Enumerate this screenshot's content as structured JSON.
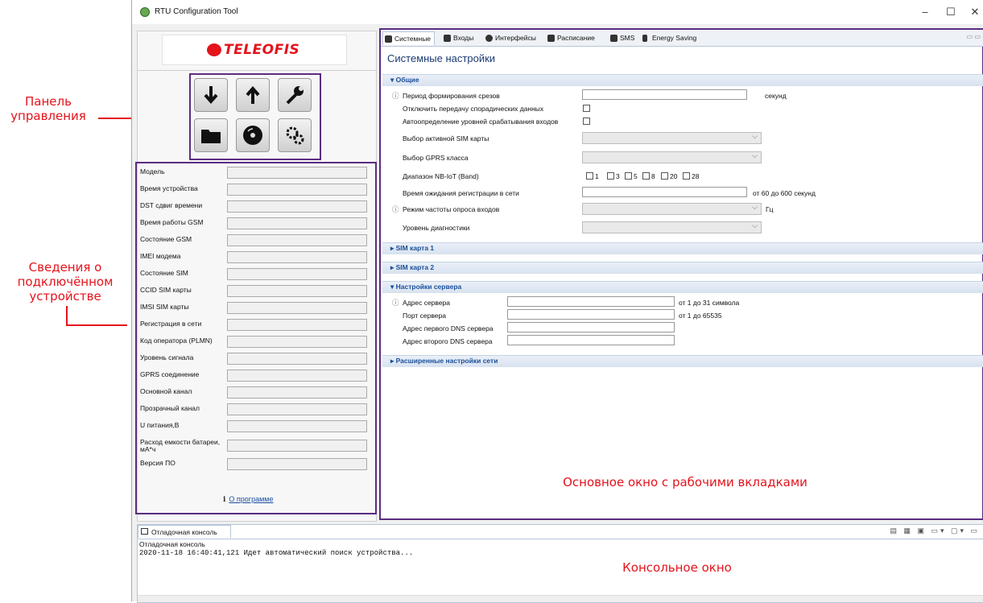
{
  "window": {
    "title": "RTU Configuration Tool",
    "min": "–",
    "max": "☐",
    "close": "✕"
  },
  "annotations": {
    "control_panel": "Панель управления",
    "device_info": "Сведения о подключённом устройстве",
    "main_window": "Основное окно с рабочими вкладками",
    "console_window": "Консольное окно"
  },
  "logo": {
    "text": "TELEOFIS"
  },
  "control_buttons": [
    {
      "icon": "download-arrow-icon"
    },
    {
      "icon": "upload-arrow-icon"
    },
    {
      "icon": "wrench-icon"
    },
    {
      "icon": "folder-icon"
    },
    {
      "icon": "disc-save-icon"
    },
    {
      "icon": "gears-icon"
    }
  ],
  "device_info": [
    {
      "label": "Модель"
    },
    {
      "label": "Время устройства"
    },
    {
      "label": "DST сдвиг времени"
    },
    {
      "label": "Время работы GSM"
    },
    {
      "label": "Состояние GSM"
    },
    {
      "label": "IMEI модема"
    },
    {
      "label": "Состояние SIM"
    },
    {
      "label": "CCID SIM карты"
    },
    {
      "label": "IMSI SIM карты"
    },
    {
      "label": "Регистрация в сети"
    },
    {
      "label": "Код оператора (PLMN)"
    },
    {
      "label": "Уровень сигнала"
    },
    {
      "label": "GPRS соединение"
    },
    {
      "label": "Основной канал"
    },
    {
      "label": "Прозрачный канал"
    },
    {
      "label": "U питания,В"
    },
    {
      "label": "Расход емкости батареи, мА*ч"
    },
    {
      "label": "Версия ПО"
    }
  ],
  "about": {
    "icon": "i",
    "link": "О программе"
  },
  "tabs": [
    {
      "label": "Системные",
      "icon": "gear-icon",
      "active": true
    },
    {
      "label": "Входы",
      "icon": "inputs-icon"
    },
    {
      "label": "Интерфейсы",
      "icon": "interfaces-icon"
    },
    {
      "label": "Расписание",
      "icon": "calendar-icon"
    },
    {
      "label": "SMS",
      "icon": "envelope-icon"
    },
    {
      "label": "Energy Saving",
      "icon": "battery-icon"
    }
  ],
  "page_title": "Системные настройки",
  "sections": {
    "general": "▾ Общие",
    "sim1": "▸ SIM карта 1",
    "sim2": "▸ SIM карта 2",
    "server": "▾ Настройки сервера",
    "advanced": "▸ Расширенные настройки сети"
  },
  "general": {
    "period_label": "Период формирования срезов",
    "period_unit": "секунд",
    "disable_sporadic_label": "Отключить передачу спорадических данных",
    "auto_levels_label": "Автоопределение уровней срабатывания входов",
    "active_sim_label": "Выбор активной SIM карты",
    "gprs_class_label": "Выбор GPRS класса",
    "nbiot_label": "Диапазон NB-IoT (Band)",
    "bands": [
      "1",
      "3",
      "5",
      "8",
      "20",
      "28"
    ],
    "reg_wait_label": "Время ожидания регистрации в сети",
    "reg_wait_unit": "от 60 до 600 секунд",
    "poll_mode_label": "Режим частоты опроса входов",
    "poll_mode_unit": "Гц",
    "diag_label": "Уровень диагностики"
  },
  "server": {
    "address_label": "Адрес сервера",
    "address_unit": "от 1 до 31 символа",
    "port_label": "Порт сервера",
    "port_unit": "от 1 до 65535",
    "dns1_label": "Адрес первого DNS сервера",
    "dns2_label": "Адрес второго DNS сервера"
  },
  "console": {
    "tab": "Отладочная консоль",
    "subtitle": "Отладочная консоль",
    "line": "2020-11-18 16:40:41,121 Идет автоматический поиск устройства..."
  },
  "colors": {
    "annotation": "#e4131c",
    "frame": "#5b2d82",
    "accent": "#1b4f9a"
  }
}
